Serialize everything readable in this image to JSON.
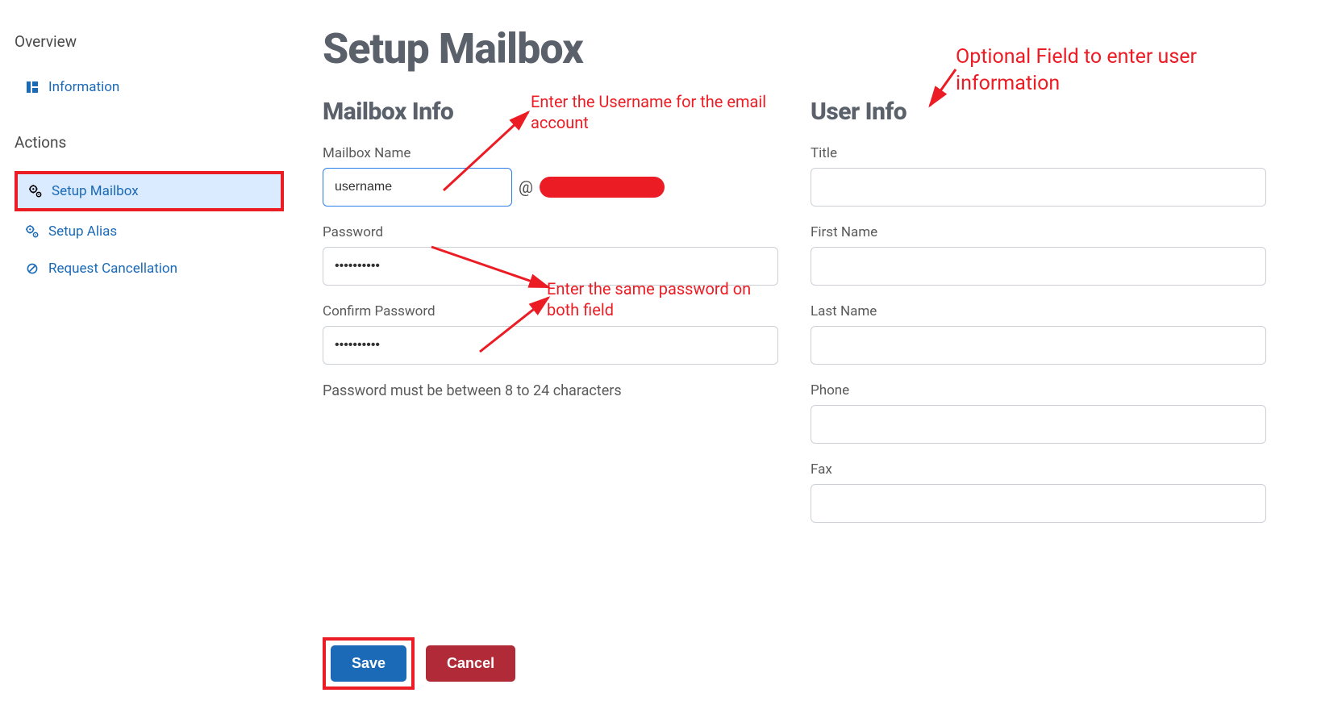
{
  "sidebar": {
    "overview_heading": "Overview",
    "information_label": "Information",
    "actions_heading": "Actions",
    "setup_mailbox_label": "Setup Mailbox",
    "setup_alias_label": "Setup Alias",
    "request_cancellation_label": "Request Cancellation"
  },
  "page": {
    "title": "Setup Mailbox"
  },
  "mailbox_info": {
    "section_title": "Mailbox Info",
    "mailbox_name_label": "Mailbox Name",
    "mailbox_name_value": "username",
    "at_symbol": "@",
    "password_label": "Password",
    "password_value": "••••••••••",
    "confirm_password_label": "Confirm Password",
    "confirm_password_value": "••••••••••",
    "password_hint": "Password must be between 8 to 24 characters"
  },
  "user_info": {
    "section_title": "User Info",
    "title_label": "Title",
    "title_value": "",
    "first_name_label": "First Name",
    "first_name_value": "",
    "last_name_label": "Last Name",
    "last_name_value": "",
    "phone_label": "Phone",
    "phone_value": "",
    "fax_label": "Fax",
    "fax_value": ""
  },
  "buttons": {
    "save_label": "Save",
    "cancel_label": "Cancel"
  },
  "annotations": {
    "username_note": "Enter the Username for the email account",
    "password_note": "Enter the same password on both field",
    "userinfo_note": "Optional Field to enter user information"
  }
}
